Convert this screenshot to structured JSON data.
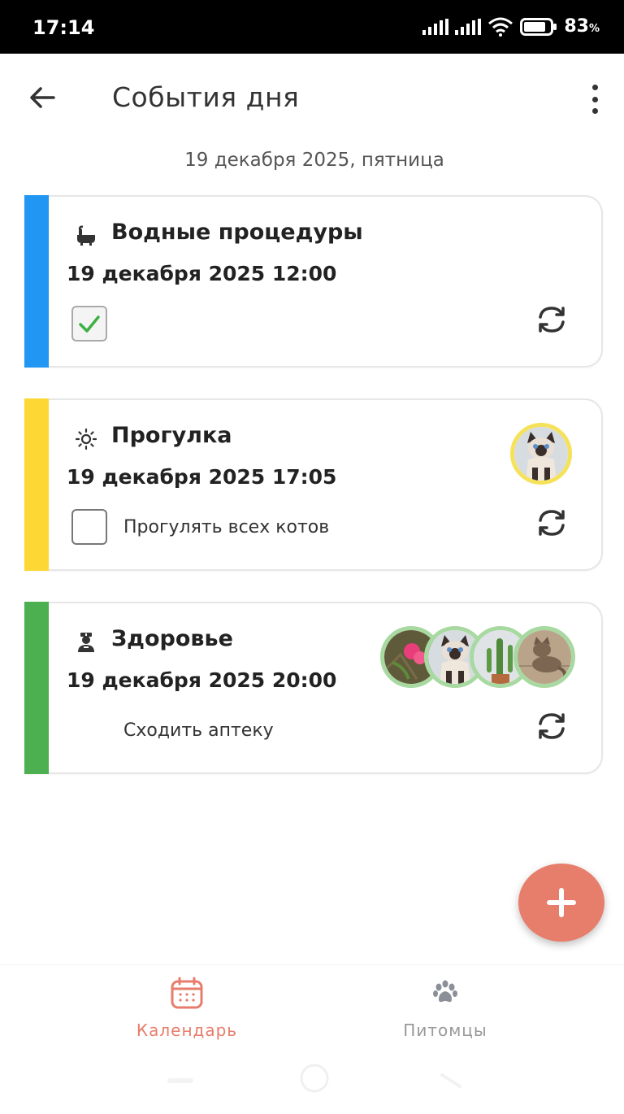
{
  "status_bar": {
    "time": "17:14",
    "battery_percent": "83",
    "battery_unit": "%"
  },
  "app_bar": {
    "title": "События дня"
  },
  "date_heading": "19 декабря 2025, пятница",
  "events": [
    {
      "title": "Водные процедуры",
      "datetime": "19 декабря 2025 12:00",
      "note": "",
      "checked": true,
      "stripe_color": "#2196f3",
      "icon": "bath-icon",
      "avatars": []
    },
    {
      "title": "Прогулка",
      "datetime": "19 декабря 2025 17:05",
      "note": "Прогулять всех котов",
      "checked": false,
      "stripe_color": "#fdd835",
      "icon": "sun-icon",
      "avatars": [
        "siamese-cat-avatar"
      ]
    },
    {
      "title": "Здоровье",
      "datetime": "19 декабря 2025 20:00",
      "note": "Сходить аптеку",
      "checked": null,
      "stripe_color": "#4caf50",
      "icon": "doctor-icon",
      "avatars": [
        "flower-avatar",
        "siamese-cat-avatar",
        "cactus-avatar",
        "tabby-cat-avatar"
      ]
    }
  ],
  "fab": {
    "icon": "plus-icon"
  },
  "bottom_nav": {
    "items": [
      {
        "label": "Календарь",
        "icon": "calendar-icon",
        "active": true
      },
      {
        "label": "Питомцы",
        "icon": "paw-icon",
        "active": false
      }
    ]
  },
  "colors": {
    "accent": "#e77d6b",
    "inactive": "#999999"
  }
}
